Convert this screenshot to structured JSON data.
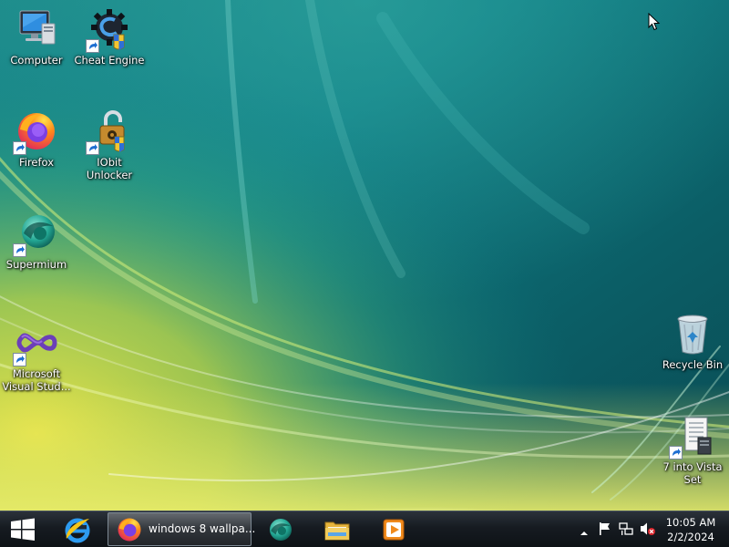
{
  "desktop": {
    "icons": [
      {
        "label": "Computer",
        "icon": "computer-icon"
      },
      {
        "label": "Cheat Engine",
        "icon": "cheat-engine-icon"
      },
      {
        "label": "Firefox",
        "icon": "firefox-icon"
      },
      {
        "label": "IObit Unlocker",
        "icon": "iobit-unlocker-icon"
      },
      {
        "label": "Supermium",
        "icon": "supermium-icon"
      },
      {
        "label": "Microsoft Visual Stud...",
        "icon": "visual-studio-icon"
      },
      {
        "label": "Recycle Bin",
        "icon": "recycle-bin-icon"
      },
      {
        "label": "7 into Vista Set",
        "icon": "vista-set-icon"
      }
    ]
  },
  "taskbar": {
    "start_icon": "windows-logo-icon",
    "pinned": [
      {
        "name": "internet-explorer",
        "icon": "internet-explorer-icon"
      },
      {
        "name": "supermium",
        "icon": "supermium-icon"
      },
      {
        "name": "file-explorer",
        "icon": "folder-icon"
      },
      {
        "name": "media-player",
        "icon": "media-player-icon"
      }
    ],
    "active_task": {
      "label": "windows 8 wallpa...",
      "icon": "firefox-icon"
    },
    "tray": {
      "icons": [
        "show-hidden-icons-arrow",
        "action-center-flag-icon",
        "network-icon",
        "volume-muted-icon"
      ],
      "time": "10:05 AM",
      "date": "2/2/2024"
    }
  },
  "colors": {
    "wallpaper_dark": "#0b4f55",
    "wallpaper_mid": "#128f92",
    "wallpaper_light": "#d8e35a",
    "taskbar": "#161b21"
  }
}
